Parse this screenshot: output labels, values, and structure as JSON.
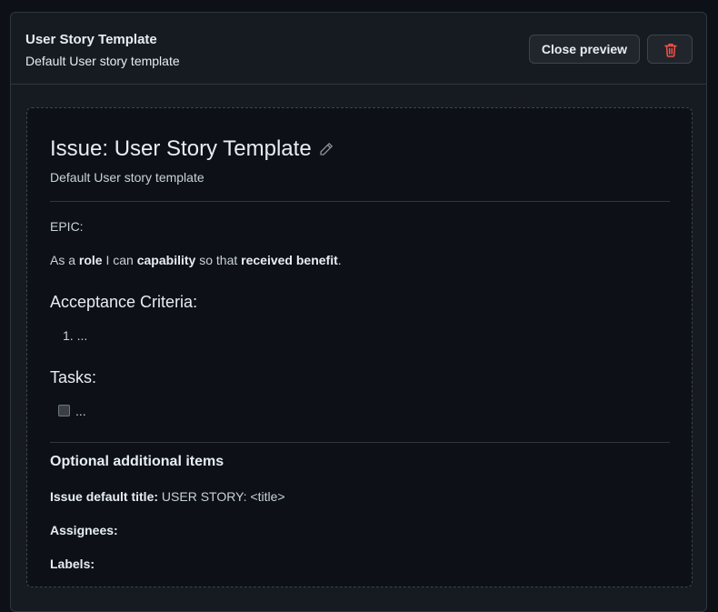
{
  "header": {
    "title": "User Story Template",
    "subtitle": "Default User story template",
    "close_label": "Close preview",
    "delete_icon": "trash-icon",
    "delete_color": "#f85149"
  },
  "preview": {
    "heading": "Issue: User Story Template",
    "edit_icon": "pencil-icon",
    "description": "Default User story template",
    "epic": "EPIC:",
    "story": {
      "as_a": "As a ",
      "role": "role",
      "i_can": " I can ",
      "capability": "capability",
      "so_that": " so that ",
      "benefit": "received benefit",
      "end": "."
    },
    "acceptance_heading": "Acceptance Criteria:",
    "acceptance_item_number": "1.",
    "acceptance_item": "...",
    "tasks_heading": "Tasks:",
    "task_item": "...",
    "optional_heading": "Optional additional items",
    "default_title_label": "Issue default title:",
    "default_title_value": " USER STORY: <title>",
    "assignees_label": "Assignees:",
    "labels_label": "Labels:"
  }
}
